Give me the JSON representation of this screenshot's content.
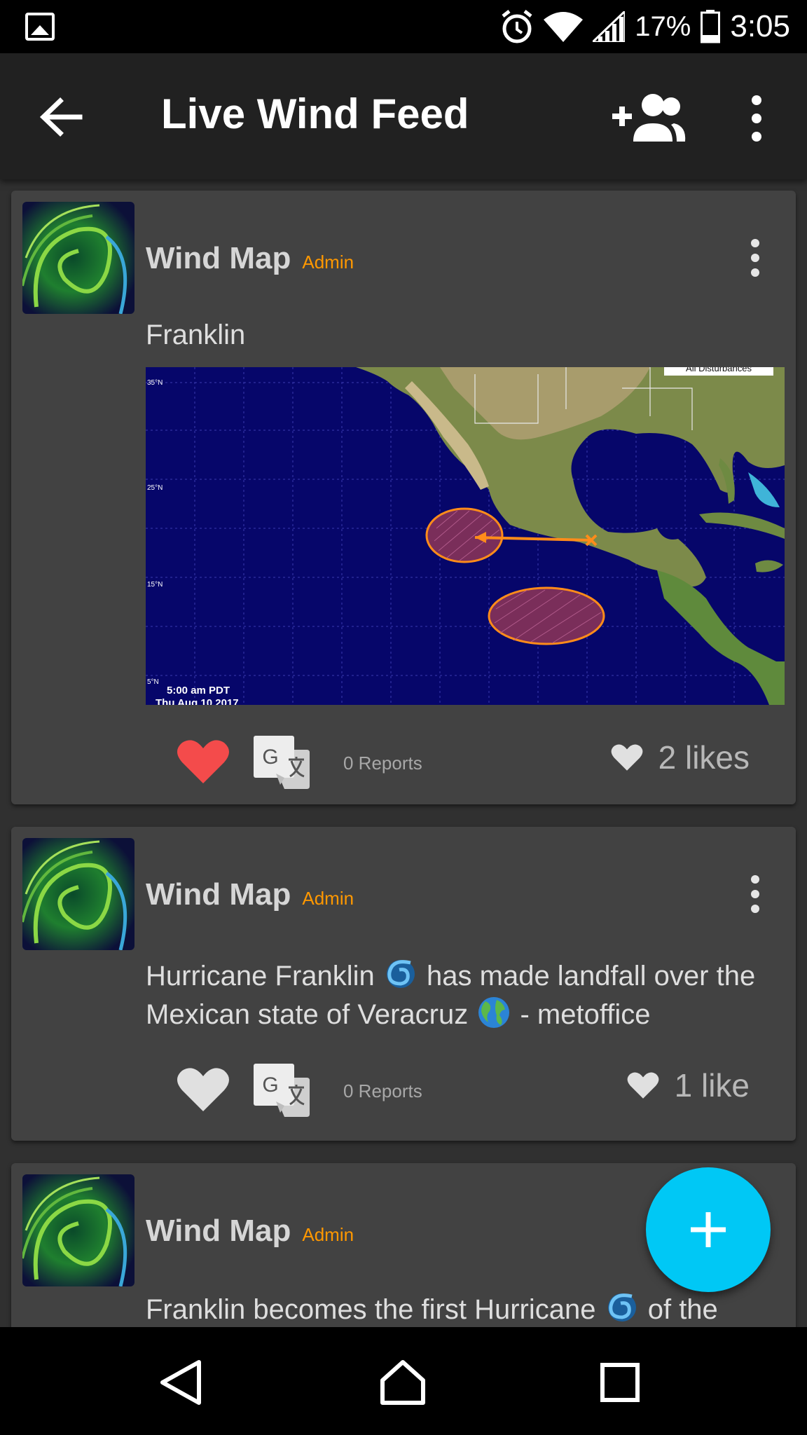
{
  "status_bar": {
    "battery": "17%",
    "time": "3:05",
    "icons": [
      "gallery-icon",
      "alarm-icon",
      "wifi-icon",
      "signal-icon",
      "battery-icon"
    ]
  },
  "app_bar": {
    "title": "Live Wind Feed",
    "icons": [
      "arrow-back-icon",
      "add-group-icon",
      "more-vert-icon"
    ]
  },
  "posts": [
    {
      "author": "Wind Map",
      "badge": "Admin",
      "text": "Franklin",
      "image": {
        "lat_labels": [
          "35°N",
          "25°N",
          "15°N",
          "5°N"
        ],
        "caption_line1": "5:00 am PDT",
        "caption_line2": "Thu Aug 10 2017",
        "legend_label": "All Disturbances"
      },
      "liked": true,
      "reports": "0 Reports",
      "likes": "2 likes"
    },
    {
      "author": "Wind Map",
      "badge": "Admin",
      "text_part1": "Hurricane Franklin",
      "text_part2": "has made landfall over the Mexican state of Veracruz",
      "text_part3": "- metoffice",
      "liked": false,
      "reports": "0 Reports",
      "likes": "1 like"
    },
    {
      "author": "Wind Map",
      "badge": "Admin",
      "text_part1": "Franklin becomes the first Hurricane",
      "text_part2": "of the"
    }
  ],
  "fab": {
    "icon": "plus-icon"
  },
  "nav_bar": {
    "icons": [
      "back-triangle-icon",
      "home-icon",
      "recents-icon"
    ]
  },
  "colors": {
    "accent": "#00c8f5",
    "badge": "#ff9800",
    "liked_heart": "#f44b4b",
    "card": "#424242",
    "background": "#303030"
  }
}
